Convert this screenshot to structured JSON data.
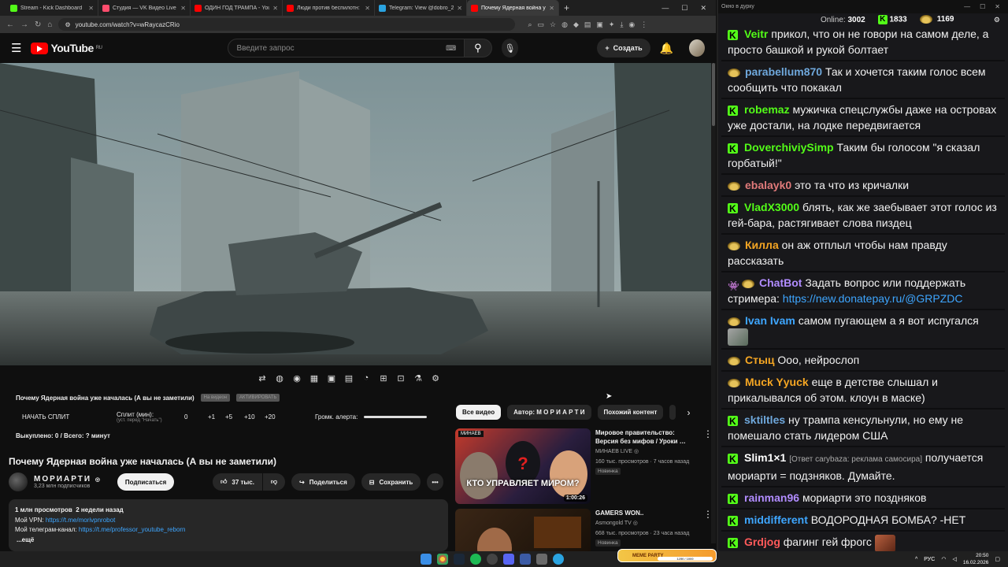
{
  "browser": {
    "tabs": [
      {
        "title": "Stream - Kick Dashboard",
        "color": "#53fc18"
      },
      {
        "title": "Студия — VK Видео Live",
        "color": "#ff4d6d"
      },
      {
        "title": "ОДИН ГОД ТРАМПА - YouTub…",
        "color": "#ff0000"
      },
      {
        "title": "Люди против беспилотн: сем…",
        "color": "#ff0000"
      },
      {
        "title": "Telegram: View @dobro_2ch",
        "color": "#2aa3e0"
      },
      {
        "title": "Почему Ядерная война у…",
        "color": "#ff0000"
      }
    ],
    "url": "youtube.com/watch?v=wRaycazCRio"
  },
  "youtube": {
    "logo_text": "YouTube",
    "region": "RU",
    "search_placeholder": "Введите запрос",
    "create_label": "Создать",
    "extension": {
      "video_title": "Почему Ядерная война уже началась (А вы не заметили)",
      "chip1": "На видеон",
      "chip2": "АКТИВИРОВАТЬ",
      "split_label": "НАЧАТЬ СПЛИТ",
      "split_min_label": "Сплит (мин):",
      "split_min_sub": "(уст. перед \"Начать\")",
      "split_value": "0",
      "add1": "+1",
      "add5": "+5",
      "add10": "+10",
      "add20": "+20",
      "alert_label": "Громк. алерта:",
      "bought": "Выкуплено: 0 / Всего: ? минут"
    },
    "video_title": "Почему Ядерная война уже началась (А вы не заметили)",
    "channel": {
      "name": "МОРИАРТИ",
      "subs": "3,23 млн подписчиков",
      "subscribe": "Подписаться"
    },
    "actions": {
      "likes": "37 тыс.",
      "share": "Поделиться",
      "save": "Сохранить"
    },
    "description": {
      "views": "1 млн просмотров",
      "date": "2 недели назад",
      "vpn_label": "Мой VPN:",
      "vpn_link": "https://t.me/morivpnrobot",
      "tg_label": "Мой телеграм-канал:",
      "tg_link": "https://t.me/professor_youtube_reborn",
      "more": "...ещё"
    },
    "chips": [
      "Все видео",
      "Автор: М О Р И А Р Т И",
      "Похожий контент"
    ],
    "recommendations": [
      {
        "title": "Мировое правительство: Версия без мифов / Уроки …",
        "channel": "МИНАЕВ LIVE",
        "meta": "160 тыс. просмотров · 7 часов назад",
        "badge": "Новинка",
        "duration": "1:00:26",
        "tag": "МИНАЕВ",
        "overlay": "КТО УПРАВЛЯЕТ МИРОМ?"
      },
      {
        "title": "GAMERS WON..",
        "channel": "Asmongold TV",
        "meta": "668 тыс. просмотров · 23 часа назад",
        "badge": "Новинка",
        "duration": "",
        "tag": "",
        "overlay": ""
      }
    ]
  },
  "chat": {
    "window_title": "Окно в дурку",
    "online_label": "Online:",
    "online": "3002",
    "kick_count": "1833",
    "other_count": "1169",
    "messages": [
      {
        "badge": "k",
        "user": "Veitr",
        "color": "#53fc18",
        "text": "прикол, что он не говори на самом деле, а просто башкой и рукой болтает"
      },
      {
        "badge": "s",
        "user": "parabellum870",
        "color": "#6fa8dc",
        "text": "Так и хочется таким голос всем сообщить что покакал"
      },
      {
        "badge": "k",
        "user": "robemaz",
        "color": "#53fc18",
        "text": "мужичка спецслужбы даже на островах уже достали, на лодке передвигается"
      },
      {
        "badge": "k",
        "user": "DoverchiviySimp",
        "color": "#53fc18",
        "text": "Таким бы голосом \"я сказал горбатый!\""
      },
      {
        "badge": "s",
        "user": "ebalayk0",
        "color": "#e07a7a",
        "text": "это та что из кричалки"
      },
      {
        "badge": "k",
        "user": "VladX3000",
        "color": "#53fc18",
        "text": "блять, как же заебывает этот голос из гей-бара, растягивает слова пиздец"
      },
      {
        "badge": "s",
        "user": "Килла",
        "color": "#f5a623",
        "text": "он аж отплыл чтобы нам правду рассказать"
      },
      {
        "badge": "bot",
        "user": "ChatBot",
        "color": "#b18cff",
        "text": "Задать вопрос или поддержать стримера:",
        "link": "https://new.donatepay.ru/@GRPZDC"
      },
      {
        "badge": "s",
        "user": "Ivan Ivam",
        "color": "#3ea6ff",
        "text": "самом пугающем а я вот испугался"
      },
      {
        "badge": "s",
        "user": "Стыц",
        "color": "#f5a623",
        "text": "Ооо, нейрослоп"
      },
      {
        "badge": "s",
        "user": "Muck Yyuck",
        "color": "#f5a623",
        "text": "еще в детстве слышал и прикалывался об этом. клоун в маске)"
      },
      {
        "badge": "k",
        "user": "sktiltles",
        "color": "#6fa8dc",
        "text": "ну трампа кенсульнули, но ему не помешало стать лидером США"
      },
      {
        "badge": "k",
        "user": "Slim1×1",
        "color": "#ffffff",
        "reply": "[Ответ carуbaza: реклама самосира]",
        "text": "получается мориарти = подзняков. Думайте."
      },
      {
        "badge": "k",
        "user": "rainman96",
        "color": "#b18cff",
        "text": "мориарти это поздняков"
      },
      {
        "badge": "k",
        "user": "middifferent",
        "color": "#3ea6ff",
        "text": "ВОДОРОДНАЯ БОМБА? -НЕТ"
      },
      {
        "badge": "k",
        "user": "Grdjog",
        "color": "#ff5a5a",
        "text": "фагинг гей фрогс"
      }
    ]
  },
  "taskbar": {
    "lang": "РУС",
    "time": "20:50",
    "date": "16.02.2026",
    "meme_label": "MEME PARTY",
    "meme_progress": "1250 / 1000"
  }
}
